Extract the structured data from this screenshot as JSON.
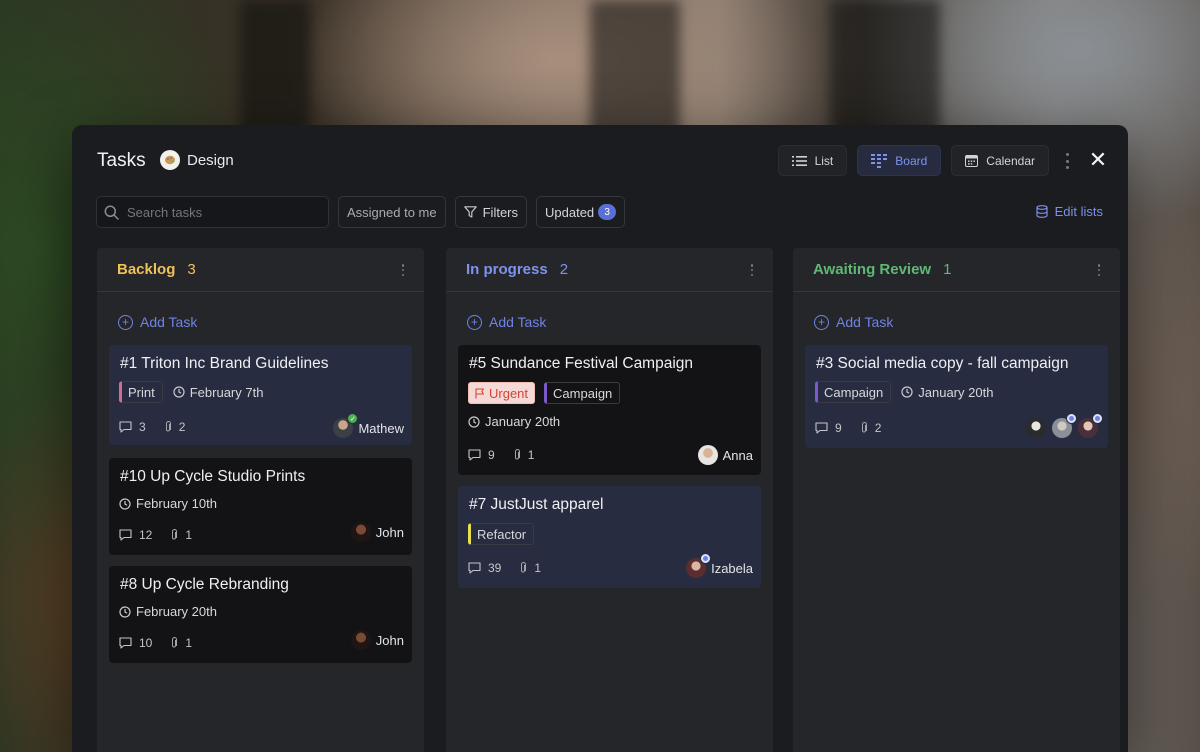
{
  "panel": {
    "title": "Tasks",
    "project": {
      "name": "Design",
      "icon": "palette-icon"
    }
  },
  "views": [
    {
      "label": "List",
      "icon": "list-icon",
      "active": false
    },
    {
      "label": "Board",
      "icon": "board-icon",
      "active": true
    },
    {
      "label": "Calendar",
      "icon": "calendar-icon",
      "active": false
    }
  ],
  "toolbar": {
    "search_placeholder": "Search tasks",
    "assigned_label": "Assigned to me",
    "filters_label": "Filters",
    "updated_label": "Updated",
    "updated_count": "3",
    "edit_lists_label": "Edit lists"
  },
  "colors": {
    "accent": "#6f83e4",
    "backlog": "#f0c15a",
    "in_progress": "#7f93ee",
    "awaiting_review": "#5fb874",
    "tag_print": "#d16c97",
    "tag_campaign": "#7b59c9",
    "tag_refactor": "#e6e04a"
  },
  "columns": [
    {
      "name": "Backlog",
      "count": "3",
      "add_label": "Add Task",
      "cards": [
        {
          "title": "#1  Triton Inc Brand Guidelines",
          "tag": "Print",
          "date": "February 7th",
          "comments": "3",
          "attachments": "2",
          "assignee": "Mathew",
          "selected": true
        },
        {
          "title": "#10  Up Cycle Studio Prints",
          "date": "February 10th",
          "comments": "12",
          "attachments": "1",
          "assignee": "John"
        },
        {
          "title": "#8  Up Cycle Rebranding",
          "date": "February 20th",
          "comments": "10",
          "attachments": "1",
          "assignee": "John"
        }
      ]
    },
    {
      "name": "In progress",
      "count": "2",
      "add_label": "Add Task",
      "cards": [
        {
          "title": "#5  Sundance Festival Campaign",
          "priority": "Urgent",
          "tag": "Campaign",
          "date": "January 20th",
          "comments": "9",
          "attachments": "1",
          "assignee": "Anna"
        },
        {
          "title": "#7  JustJust apparel",
          "tag": "Refactor",
          "comments": "39",
          "attachments": "1",
          "assignee": "Izabela",
          "selected": true
        }
      ]
    },
    {
      "name": "Awaiting Review",
      "count": "1",
      "add_label": "Add Task",
      "cards": [
        {
          "title": "#3  Social media copy - fall campaign",
          "tag": "Campaign",
          "date": "January 20th",
          "comments": "9",
          "attachments": "2",
          "selected": true
        }
      ]
    }
  ]
}
